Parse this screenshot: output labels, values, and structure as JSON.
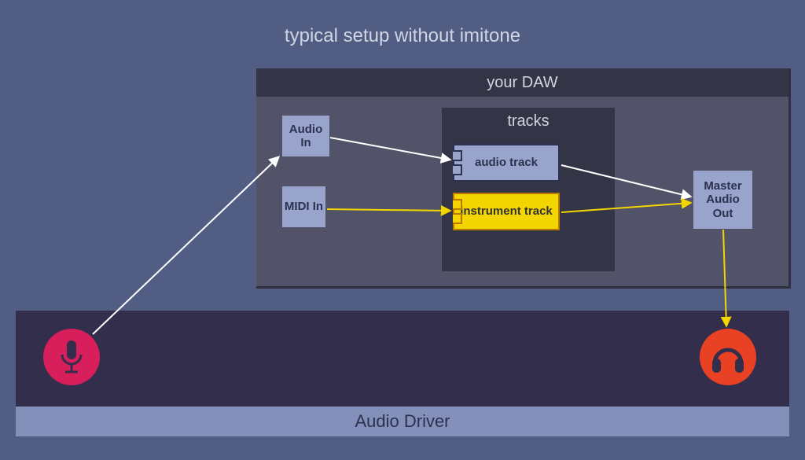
{
  "title": "typical setup without imitone",
  "daw": {
    "header": "your DAW",
    "audio_in": "Audio In",
    "midi_in": "MIDI In",
    "master_out": "Master Audio Out",
    "tracks_label": "tracks",
    "audio_track": "audio track",
    "instrument_track": "instrument track"
  },
  "driver_label": "Audio Driver",
  "icons": {
    "microphone": "microphone-icon",
    "headphones": "headphones-icon"
  },
  "colors": {
    "background": "#525d84",
    "daw_box": "#525368",
    "daw_header": "#333446",
    "node_blue": "#98a4cc",
    "node_yellow": "#f3d600",
    "driver_bar": "#332e4c",
    "driver_label": "#8290ba",
    "mic": "#d81e5b",
    "headphones": "#e94124",
    "arrow_white": "#ffffff",
    "arrow_yellow": "#f3d600"
  },
  "arrows": [
    {
      "from": "microphone",
      "to": "audio_in",
      "color": "white"
    },
    {
      "from": "audio_in",
      "to": "audio_track",
      "color": "white"
    },
    {
      "from": "audio_track",
      "to": "master_out",
      "color": "white"
    },
    {
      "from": "midi_in",
      "to": "instrument_track",
      "color": "yellow"
    },
    {
      "from": "instrument_track",
      "to": "master_out",
      "color": "yellow"
    },
    {
      "from": "master_out",
      "to": "headphones",
      "color": "yellow"
    }
  ]
}
